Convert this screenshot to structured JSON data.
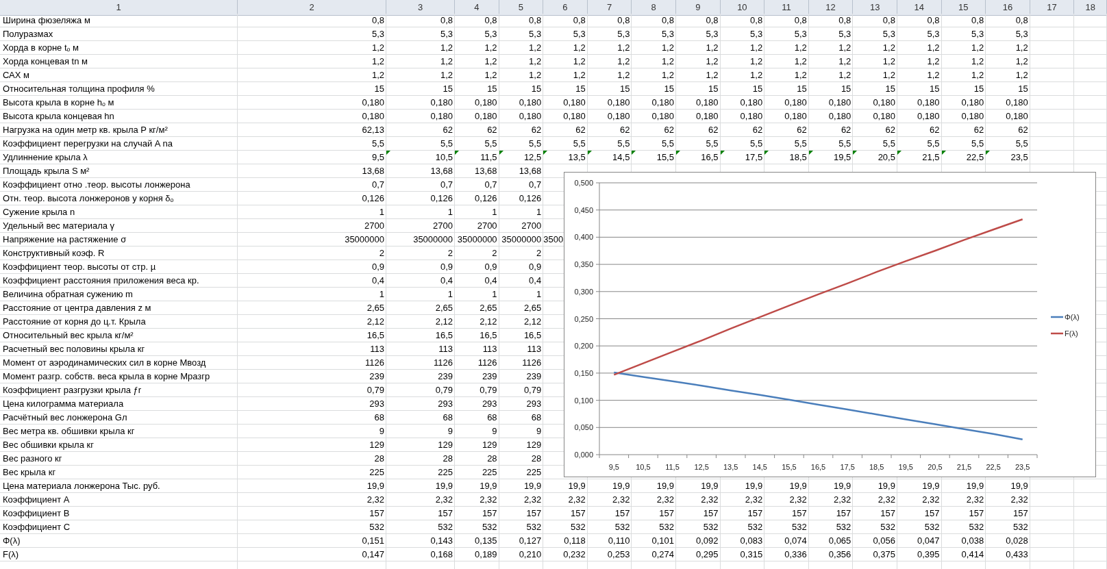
{
  "columns": [
    "1",
    "2",
    "3",
    "4",
    "5",
    "6",
    "7",
    "8",
    "9",
    "10",
    "11",
    "12",
    "13",
    "14",
    "15",
    "16",
    "17",
    "18"
  ],
  "rows": [
    {
      "label": "Ширина фюзеляжа м",
      "values": [
        "0,8",
        "0,8",
        "0,8",
        "0,8",
        "0,8",
        "0,8",
        "0,8",
        "0,8",
        "0,8",
        "0,8",
        "0,8",
        "0,8",
        "0,8",
        "0,8",
        "0,8"
      ]
    },
    {
      "label": "Полуразмах",
      "values": [
        "5,3",
        "5,3",
        "5,3",
        "5,3",
        "5,3",
        "5,3",
        "5,3",
        "5,3",
        "5,3",
        "5,3",
        "5,3",
        "5,3",
        "5,3",
        "5,3",
        "5,3"
      ]
    },
    {
      "label": "Хорда в корне tₒ м",
      "values": [
        "1,2",
        "1,2",
        "1,2",
        "1,2",
        "1,2",
        "1,2",
        "1,2",
        "1,2",
        "1,2",
        "1,2",
        "1,2",
        "1,2",
        "1,2",
        "1,2",
        "1,2"
      ]
    },
    {
      "label": "Хорда концевая tn м",
      "values": [
        "1,2",
        "1,2",
        "1,2",
        "1,2",
        "1,2",
        "1,2",
        "1,2",
        "1,2",
        "1,2",
        "1,2",
        "1,2",
        "1,2",
        "1,2",
        "1,2",
        "1,2"
      ]
    },
    {
      "label": "САХ м",
      "values": [
        "1,2",
        "1,2",
        "1,2",
        "1,2",
        "1,2",
        "1,2",
        "1,2",
        "1,2",
        "1,2",
        "1,2",
        "1,2",
        "1,2",
        "1,2",
        "1,2",
        "1,2"
      ]
    },
    {
      "label": "Относительная толщина профиля %",
      "values": [
        "15",
        "15",
        "15",
        "15",
        "15",
        "15",
        "15",
        "15",
        "15",
        "15",
        "15",
        "15",
        "15",
        "15",
        "15"
      ]
    },
    {
      "label": "Высота крыла в корне hₒ м",
      "values": [
        "0,180",
        "0,180",
        "0,180",
        "0,180",
        "0,180",
        "0,180",
        "0,180",
        "0,180",
        "0,180",
        "0,180",
        "0,180",
        "0,180",
        "0,180",
        "0,180",
        "0,180"
      ]
    },
    {
      "label": "Высота крыла концевая hn",
      "values": [
        "0,180",
        "0,180",
        "0,180",
        "0,180",
        "0,180",
        "0,180",
        "0,180",
        "0,180",
        "0,180",
        "0,180",
        "0,180",
        "0,180",
        "0,180",
        "0,180",
        "0,180"
      ]
    },
    {
      "label": "Нагрузка на один метр кв. крыла P кг/м²",
      "values": [
        "62,13",
        "62",
        "62",
        "62",
        "62",
        "62",
        "62",
        "62",
        "62",
        "62",
        "62",
        "62",
        "62",
        "62",
        "62"
      ]
    },
    {
      "label": "Коэффициент перегрузки на случай A na",
      "values": [
        "5,5",
        "5,5",
        "5,5",
        "5,5",
        "5,5",
        "5,5",
        "5,5",
        "5,5",
        "5,5",
        "5,5",
        "5,5",
        "5,5",
        "5,5",
        "5,5",
        "5,5"
      ]
    },
    {
      "label": "Удлиннение крыла λ",
      "values": [
        "9,5",
        "10,5",
        "11,5",
        "12,5",
        "13,5",
        "14,5",
        "15,5",
        "16,5",
        "17,5",
        "18,5",
        "19,5",
        "20,5",
        "21,5",
        "22,5",
        "23,5"
      ],
      "flags": [
        false,
        true,
        true,
        true,
        true,
        true,
        true,
        true,
        true,
        true,
        true,
        true,
        true,
        true,
        true
      ]
    },
    {
      "label": "Площадь крыла S м²",
      "values": [
        "13,68",
        "13,68",
        "13,68",
        "13,68"
      ]
    },
    {
      "label": "Коэффициент отно .теор. высоты лонжерона",
      "values": [
        "0,7",
        "0,7",
        "0,7",
        "0,7"
      ]
    },
    {
      "label": "Отн. теор. высота лонжеронов у корня δₒ",
      "values": [
        "0,126",
        "0,126",
        "0,126",
        "0,126"
      ]
    },
    {
      "label": "Сужение крыла n",
      "values": [
        "1",
        "1",
        "1",
        "1"
      ]
    },
    {
      "label": "Удельный вес материала γ",
      "values": [
        "2700",
        "2700",
        "2700",
        "2700"
      ]
    },
    {
      "label": "Напряжение на растяжение σ",
      "values": [
        "35000000",
        "35000000",
        "35000000",
        "35000000"
      ],
      "overflow": "3500"
    },
    {
      "label": "Конструктивный коэф. R",
      "values": [
        "2",
        "2",
        "2",
        "2"
      ]
    },
    {
      "label": "Коэффициент теор.  высоты  от стр. µ",
      "values": [
        "0,9",
        "0,9",
        "0,9",
        "0,9"
      ]
    },
    {
      "label": "Коэффициент расстояния приложения веса кр.",
      "values": [
        "0,4",
        "0,4",
        "0,4",
        "0,4"
      ]
    },
    {
      "label": "Величина обратная сужению m",
      "values": [
        "1",
        "1",
        "1",
        "1"
      ]
    },
    {
      "label": "Расстояние от центра давления z м",
      "values": [
        "2,65",
        "2,65",
        "2,65",
        "2,65"
      ]
    },
    {
      "label": "Расстояние от корня до ц.т. Крыла",
      "values": [
        "2,12",
        "2,12",
        "2,12",
        "2,12"
      ]
    },
    {
      "label": "Относительный вес крыла кг/м²",
      "values": [
        "16,5",
        "16,5",
        "16,5",
        "16,5"
      ]
    },
    {
      "label": "Расчетный вес половины крыла кг",
      "values": [
        "113",
        "113",
        "113",
        "113"
      ]
    },
    {
      "label": "Момент от аэродинамических сил в корне Mвозд",
      "values": [
        "1126",
        "1126",
        "1126",
        "1126"
      ]
    },
    {
      "label": "Момент разгр. собств. веса крыла в корне Мразгр",
      "values": [
        "239",
        "239",
        "239",
        "239"
      ]
    },
    {
      "label": "Коэффициент разгрузки крыла ƒr",
      "values": [
        "0,79",
        "0,79",
        "0,79",
        "0,79"
      ]
    },
    {
      "label": "Цена килограмма материала",
      "values": [
        "293",
        "293",
        "293",
        "293"
      ]
    },
    {
      "label": "Расчётный вес лонжерона Gл",
      "values": [
        "68",
        "68",
        "68",
        "68"
      ]
    },
    {
      "label": "Вес метра кв. обшивки крыла кг",
      "values": [
        "9",
        "9",
        "9",
        "9"
      ]
    },
    {
      "label": "Вес обшивки крыла кг",
      "values": [
        "129",
        "129",
        "129",
        "129"
      ]
    },
    {
      "label": "Вес разного кг",
      "values": [
        "28",
        "28",
        "28",
        "28"
      ]
    },
    {
      "label": "Вес крыла кг",
      "values": [
        "225",
        "225",
        "225",
        "225"
      ]
    },
    {
      "label": "Цена материала лонжерона Тыс. руб.",
      "values": [
        "19,9",
        "19,9",
        "19,9",
        "19,9",
        "19,9",
        "19,9",
        "19,9",
        "19,9",
        "19,9",
        "19,9",
        "19,9",
        "19,9",
        "19,9",
        "19,9",
        "19,9"
      ]
    },
    {
      "label": "Коэффициент A",
      "values": [
        "2,32",
        "2,32",
        "2,32",
        "2,32",
        "2,32",
        "2,32",
        "2,32",
        "2,32",
        "2,32",
        "2,32",
        "2,32",
        "2,32",
        "2,32",
        "2,32",
        "2,32"
      ]
    },
    {
      "label": "Коэффициент B",
      "values": [
        "157",
        "157",
        "157",
        "157",
        "157",
        "157",
        "157",
        "157",
        "157",
        "157",
        "157",
        "157",
        "157",
        "157",
        "157"
      ]
    },
    {
      "label": "Коэффициент C",
      "values": [
        "532",
        "532",
        "532",
        "532",
        "532",
        "532",
        "532",
        "532",
        "532",
        "532",
        "532",
        "532",
        "532",
        "532",
        "532"
      ]
    },
    {
      "label": "Φ(λ)",
      "values": [
        "0,151",
        "0,143",
        "0,135",
        "0,127",
        "0,118",
        "0,110",
        "0,101",
        "0,092",
        "0,083",
        "0,074",
        "0,065",
        "0,056",
        "0,047",
        "0,038",
        "0,028"
      ]
    },
    {
      "label": "F(λ)",
      "values": [
        "0,147",
        "0,168",
        "0,189",
        "0,210",
        "0,232",
        "0,253",
        "0,274",
        "0,295",
        "0,315",
        "0,336",
        "0,356",
        "0,375",
        "0,395",
        "0,414",
        "0,433"
      ]
    }
  ],
  "chart": {
    "chart_data": {
      "type": "line",
      "grid": true,
      "legend": "right",
      "categories": [
        "9,5",
        "10,5",
        "11,5",
        "12,5",
        "13,5",
        "14,5",
        "15,5",
        "16,5",
        "17,5",
        "18,5",
        "19,5",
        "20,5",
        "21,5",
        "22,5",
        "23,5"
      ],
      "series": [
        {
          "name": "Φ(λ)",
          "color": "#4a7ebb",
          "values": [
            0.151,
            0.143,
            0.135,
            0.127,
            0.118,
            0.11,
            0.101,
            0.092,
            0.083,
            0.074,
            0.065,
            0.056,
            0.047,
            0.038,
            0.028
          ]
        },
        {
          "name": "F(λ)",
          "color": "#be4b48",
          "values": [
            0.147,
            0.168,
            0.189,
            0.21,
            0.232,
            0.253,
            0.274,
            0.295,
            0.315,
            0.336,
            0.356,
            0.375,
            0.395,
            0.414,
            0.433
          ]
        }
      ],
      "ylim": [
        0,
        0.5
      ],
      "yticks": [
        {
          "value": 0,
          "label": "0,000"
        },
        {
          "value": 0.05,
          "label": "0,050"
        },
        {
          "value": 0.1,
          "label": "0,100"
        },
        {
          "value": 0.15,
          "label": "0,150"
        },
        {
          "value": 0.2,
          "label": "0,200"
        },
        {
          "value": 0.25,
          "label": "0,250"
        },
        {
          "value": 0.3,
          "label": "0,300"
        },
        {
          "value": 0.35,
          "label": "0,350"
        },
        {
          "value": 0.4,
          "label": "0,400"
        },
        {
          "value": 0.45,
          "label": "0,450"
        },
        {
          "value": 0.5,
          "label": "0,500"
        }
      ]
    }
  }
}
